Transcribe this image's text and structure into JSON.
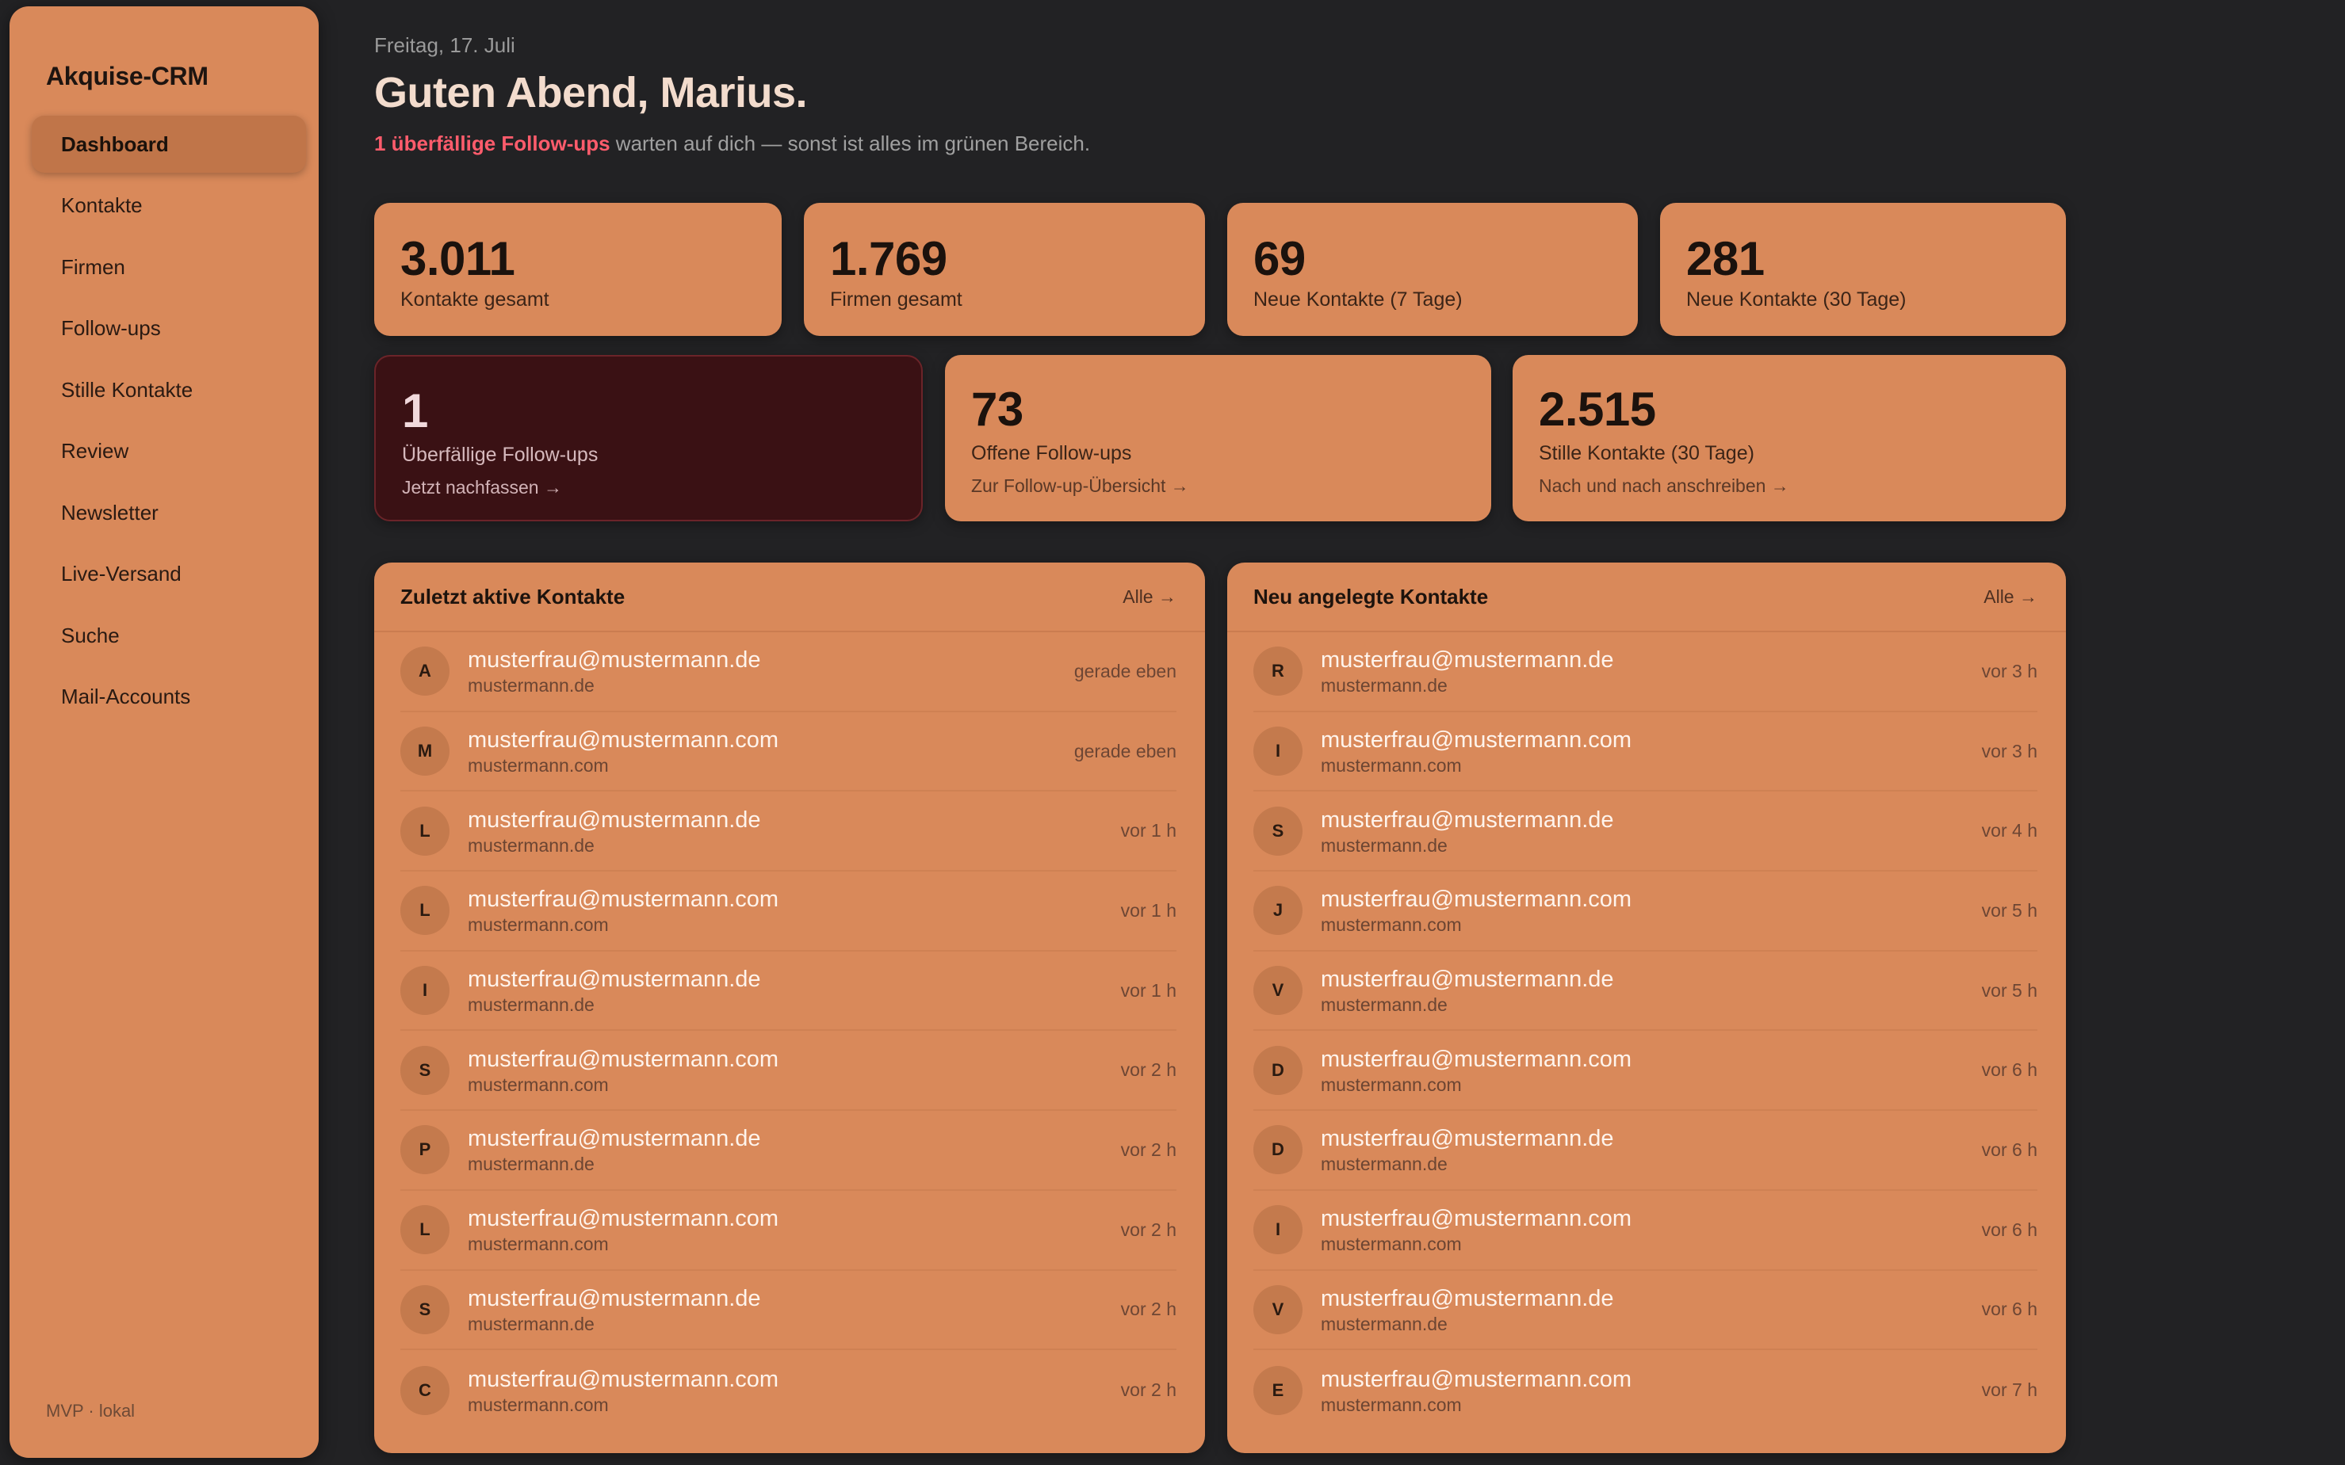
{
  "sidebar": {
    "brand": "Akquise-CRM",
    "items": [
      {
        "label": "Dashboard",
        "active": true
      },
      {
        "label": "Kontakte"
      },
      {
        "label": "Firmen"
      },
      {
        "label": "Follow-ups"
      },
      {
        "label": "Stille Kontakte"
      },
      {
        "label": "Review"
      },
      {
        "label": "Newsletter"
      },
      {
        "label": "Live-Versand"
      },
      {
        "label": "Suche"
      },
      {
        "label": "Mail-Accounts"
      }
    ],
    "footer": "MVP · lokal"
  },
  "header": {
    "date": "Freitag, 17. Juli",
    "greeting": "Guten Abend, Marius.",
    "alert_text": "1 überfällige Follow-ups",
    "subtitle_rest": " warten auf dich — sonst ist alles im grünen Bereich."
  },
  "stats_row1": [
    {
      "value": "3.011",
      "label": "Kontakte gesamt"
    },
    {
      "value": "1.769",
      "label": "Firmen gesamt"
    },
    {
      "value": "69",
      "label": "Neue Kontakte (7 Tage)"
    },
    {
      "value": "281",
      "label": "Neue Kontakte (30 Tage)"
    }
  ],
  "stats_row2": [
    {
      "value": "1",
      "label": "Überfällige Follow-ups",
      "link": "Jetzt nachfassen →"
    },
    {
      "value": "73",
      "label": "Offene Follow-ups",
      "link": "Zur Follow-up-Übersicht →"
    },
    {
      "value": "2.515",
      "label": "Stille Kontakte (30 Tage)",
      "link": "Nach und nach anschreiben →"
    }
  ],
  "recent_panel": {
    "title": "Zuletzt aktive Kontakte",
    "link": "Alle →",
    "rows": [
      {
        "initial": "A",
        "email": "musterfrau@mustermann.de",
        "domain": "mustermann.de",
        "time": "gerade eben"
      },
      {
        "initial": "M",
        "email": "musterfrau@mustermann.com",
        "domain": "mustermann.com",
        "time": "gerade eben"
      },
      {
        "initial": "L",
        "email": "musterfrau@mustermann.de",
        "domain": "mustermann.de",
        "time": "vor 1 h"
      },
      {
        "initial": "L",
        "email": "musterfrau@mustermann.com",
        "domain": "mustermann.com",
        "time": "vor 1 h"
      },
      {
        "initial": "I",
        "email": "musterfrau@mustermann.de",
        "domain": "mustermann.de",
        "time": "vor 1 h"
      },
      {
        "initial": "S",
        "email": "musterfrau@mustermann.com",
        "domain": "mustermann.com",
        "time": "vor 2 h"
      },
      {
        "initial": "P",
        "email": "musterfrau@mustermann.de",
        "domain": "mustermann.de",
        "time": "vor 2 h"
      },
      {
        "initial": "L",
        "email": "musterfrau@mustermann.com",
        "domain": "mustermann.com",
        "time": "vor 2 h"
      },
      {
        "initial": "S",
        "email": "musterfrau@mustermann.de",
        "domain": "mustermann.de",
        "time": "vor 2 h"
      },
      {
        "initial": "C",
        "email": "musterfrau@mustermann.com",
        "domain": "mustermann.com",
        "time": "vor 2 h"
      }
    ]
  },
  "new_panel": {
    "title": "Neu angelegte Kontakte",
    "link": "Alle →",
    "rows": [
      {
        "initial": "R",
        "email": "musterfrau@mustermann.de",
        "domain": "mustermann.de",
        "time": "vor 3 h"
      },
      {
        "initial": "I",
        "email": "musterfrau@mustermann.com",
        "domain": "mustermann.com",
        "time": "vor 3 h"
      },
      {
        "initial": "S",
        "email": "musterfrau@mustermann.de",
        "domain": "mustermann.de",
        "time": "vor 4 h"
      },
      {
        "initial": "J",
        "email": "musterfrau@mustermann.com",
        "domain": "mustermann.com",
        "time": "vor 5 h"
      },
      {
        "initial": "V",
        "email": "musterfrau@mustermann.de",
        "domain": "mustermann.de",
        "time": "vor 5 h"
      },
      {
        "initial": "D",
        "email": "musterfrau@mustermann.com",
        "domain": "mustermann.com",
        "time": "vor 6 h"
      },
      {
        "initial": "D",
        "email": "musterfrau@mustermann.de",
        "domain": "mustermann.de",
        "time": "vor 6 h"
      },
      {
        "initial": "I",
        "email": "musterfrau@mustermann.com",
        "domain": "mustermann.com",
        "time": "vor 6 h"
      },
      {
        "initial": "V",
        "email": "musterfrau@mustermann.de",
        "domain": "mustermann.de",
        "time": "vor 6 h"
      },
      {
        "initial": "E",
        "email": "musterfrau@mustermann.com",
        "domain": "mustermann.com",
        "time": "vor 7 h"
      }
    ]
  },
  "colors": {
    "background": "#222224",
    "card": "#d9895a",
    "danger_card": "#3a1114",
    "alert": "#ff5c6c"
  }
}
